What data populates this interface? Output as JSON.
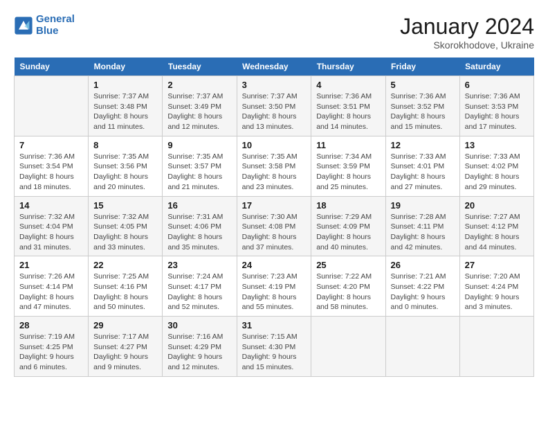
{
  "header": {
    "logo_line1": "General",
    "logo_line2": "Blue",
    "month": "January 2024",
    "location": "Skorokhodove, Ukraine"
  },
  "weekdays": [
    "Sunday",
    "Monday",
    "Tuesday",
    "Wednesday",
    "Thursday",
    "Friday",
    "Saturday"
  ],
  "weeks": [
    [
      {
        "day": "",
        "info": ""
      },
      {
        "day": "1",
        "info": "Sunrise: 7:37 AM\nSunset: 3:48 PM\nDaylight: 8 hours\nand 11 minutes."
      },
      {
        "day": "2",
        "info": "Sunrise: 7:37 AM\nSunset: 3:49 PM\nDaylight: 8 hours\nand 12 minutes."
      },
      {
        "day": "3",
        "info": "Sunrise: 7:37 AM\nSunset: 3:50 PM\nDaylight: 8 hours\nand 13 minutes."
      },
      {
        "day": "4",
        "info": "Sunrise: 7:36 AM\nSunset: 3:51 PM\nDaylight: 8 hours\nand 14 minutes."
      },
      {
        "day": "5",
        "info": "Sunrise: 7:36 AM\nSunset: 3:52 PM\nDaylight: 8 hours\nand 15 minutes."
      },
      {
        "day": "6",
        "info": "Sunrise: 7:36 AM\nSunset: 3:53 PM\nDaylight: 8 hours\nand 17 minutes."
      }
    ],
    [
      {
        "day": "7",
        "info": "Sunrise: 7:36 AM\nSunset: 3:54 PM\nDaylight: 8 hours\nand 18 minutes."
      },
      {
        "day": "8",
        "info": "Sunrise: 7:35 AM\nSunset: 3:56 PM\nDaylight: 8 hours\nand 20 minutes."
      },
      {
        "day": "9",
        "info": "Sunrise: 7:35 AM\nSunset: 3:57 PM\nDaylight: 8 hours\nand 21 minutes."
      },
      {
        "day": "10",
        "info": "Sunrise: 7:35 AM\nSunset: 3:58 PM\nDaylight: 8 hours\nand 23 minutes."
      },
      {
        "day": "11",
        "info": "Sunrise: 7:34 AM\nSunset: 3:59 PM\nDaylight: 8 hours\nand 25 minutes."
      },
      {
        "day": "12",
        "info": "Sunrise: 7:33 AM\nSunset: 4:01 PM\nDaylight: 8 hours\nand 27 minutes."
      },
      {
        "day": "13",
        "info": "Sunrise: 7:33 AM\nSunset: 4:02 PM\nDaylight: 8 hours\nand 29 minutes."
      }
    ],
    [
      {
        "day": "14",
        "info": "Sunrise: 7:32 AM\nSunset: 4:04 PM\nDaylight: 8 hours\nand 31 minutes."
      },
      {
        "day": "15",
        "info": "Sunrise: 7:32 AM\nSunset: 4:05 PM\nDaylight: 8 hours\nand 33 minutes."
      },
      {
        "day": "16",
        "info": "Sunrise: 7:31 AM\nSunset: 4:06 PM\nDaylight: 8 hours\nand 35 minutes."
      },
      {
        "day": "17",
        "info": "Sunrise: 7:30 AM\nSunset: 4:08 PM\nDaylight: 8 hours\nand 37 minutes."
      },
      {
        "day": "18",
        "info": "Sunrise: 7:29 AM\nSunset: 4:09 PM\nDaylight: 8 hours\nand 40 minutes."
      },
      {
        "day": "19",
        "info": "Sunrise: 7:28 AM\nSunset: 4:11 PM\nDaylight: 8 hours\nand 42 minutes."
      },
      {
        "day": "20",
        "info": "Sunrise: 7:27 AM\nSunset: 4:12 PM\nDaylight: 8 hours\nand 44 minutes."
      }
    ],
    [
      {
        "day": "21",
        "info": "Sunrise: 7:26 AM\nSunset: 4:14 PM\nDaylight: 8 hours\nand 47 minutes."
      },
      {
        "day": "22",
        "info": "Sunrise: 7:25 AM\nSunset: 4:16 PM\nDaylight: 8 hours\nand 50 minutes."
      },
      {
        "day": "23",
        "info": "Sunrise: 7:24 AM\nSunset: 4:17 PM\nDaylight: 8 hours\nand 52 minutes."
      },
      {
        "day": "24",
        "info": "Sunrise: 7:23 AM\nSunset: 4:19 PM\nDaylight: 8 hours\nand 55 minutes."
      },
      {
        "day": "25",
        "info": "Sunrise: 7:22 AM\nSunset: 4:20 PM\nDaylight: 8 hours\nand 58 minutes."
      },
      {
        "day": "26",
        "info": "Sunrise: 7:21 AM\nSunset: 4:22 PM\nDaylight: 9 hours\nand 0 minutes."
      },
      {
        "day": "27",
        "info": "Sunrise: 7:20 AM\nSunset: 4:24 PM\nDaylight: 9 hours\nand 3 minutes."
      }
    ],
    [
      {
        "day": "28",
        "info": "Sunrise: 7:19 AM\nSunset: 4:25 PM\nDaylight: 9 hours\nand 6 minutes."
      },
      {
        "day": "29",
        "info": "Sunrise: 7:17 AM\nSunset: 4:27 PM\nDaylight: 9 hours\nand 9 minutes."
      },
      {
        "day": "30",
        "info": "Sunrise: 7:16 AM\nSunset: 4:29 PM\nDaylight: 9 hours\nand 12 minutes."
      },
      {
        "day": "31",
        "info": "Sunrise: 7:15 AM\nSunset: 4:30 PM\nDaylight: 9 hours\nand 15 minutes."
      },
      {
        "day": "",
        "info": ""
      },
      {
        "day": "",
        "info": ""
      },
      {
        "day": "",
        "info": ""
      }
    ]
  ]
}
